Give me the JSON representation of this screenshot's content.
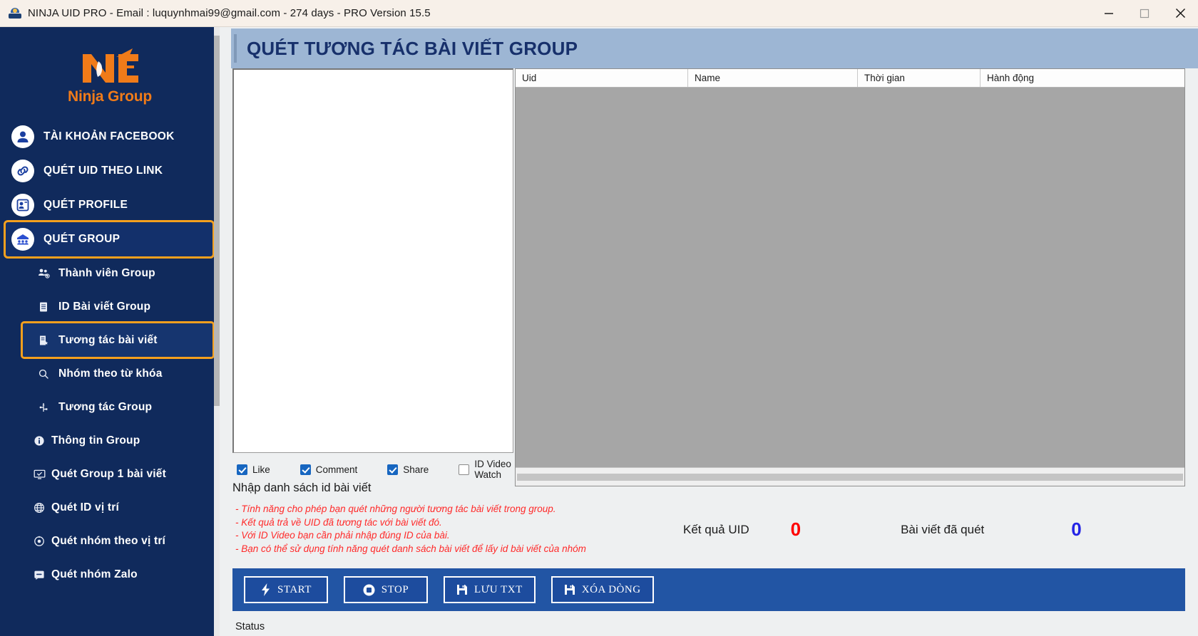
{
  "window": {
    "title": "NINJA UID PRO - Email : luquynhmai99@gmail.com  -  274 days -  PRO Version 15.5",
    "minimize_label": "minimize",
    "maximize_label": "maximize",
    "close_label": "close"
  },
  "sidebar": {
    "logo_text": "Ninja Group",
    "main_items": [
      {
        "label": "TÀI KHOẢN FACEBOOK",
        "icon": "user-icon",
        "selected": false
      },
      {
        "label": "QUÉT UID THEO LINK",
        "icon": "link-icon",
        "selected": false
      },
      {
        "label": "QUÉT PROFILE",
        "icon": "profile-card-icon",
        "selected": false
      },
      {
        "label": "QUÉT GROUP",
        "icon": "group-icon",
        "selected": true
      }
    ],
    "sub_items": [
      {
        "label": "Thành viên Group",
        "icon": "members-icon",
        "selected": false
      },
      {
        "label": "ID Bài viết Group",
        "icon": "document-icon",
        "selected": false
      },
      {
        "label": "Tương tác bài viết",
        "icon": "post-star-icon",
        "selected": true
      },
      {
        "label": "Nhóm theo từ khóa",
        "icon": "search-icon",
        "selected": false
      },
      {
        "label": "Tương tác Group",
        "icon": "usb-icon",
        "selected": false
      },
      {
        "label": "Thông tin Group",
        "icon": "info-icon",
        "selected": false
      },
      {
        "label": "Quét Group 1 bài viết",
        "icon": "monitor-icon",
        "selected": false
      },
      {
        "label": "Quét  ID vị trí",
        "icon": "globe-icon",
        "selected": false
      },
      {
        "label": "Quét nhóm theo vị trí",
        "icon": "target-icon",
        "selected": false
      },
      {
        "label": "Quét nhóm Zalo",
        "icon": "chat-icon",
        "selected": false
      }
    ]
  },
  "page": {
    "title": "QUÉT TƯƠNG TÁC BÀI VIẾT GROUP"
  },
  "input_area": {
    "value": "",
    "label": "Nhập danh sách id bài viết"
  },
  "checkboxes": [
    {
      "label": "Like",
      "checked": true
    },
    {
      "label": "Comment",
      "checked": true
    },
    {
      "label": "Share",
      "checked": true
    },
    {
      "label": "ID Video Watch",
      "checked": false
    }
  ],
  "notes": [
    "- Tính năng cho phép bạn quét những người tương tác bài viết trong group.",
    "- Kết quả trả về UID đã tương tác với bài viết đó.",
    "- Với ID Video bạn cần phải nhập đúng ID của bài.",
    "- Bạn có thể sử dụng tính năng quét danh sách bài viết để lấy id bài viết của nhóm"
  ],
  "table": {
    "columns": [
      "Uid",
      "Name",
      "Thời gian",
      "Hành động"
    ],
    "rows": []
  },
  "counters": {
    "uid_label": "Kết quả UID",
    "uid_value": "0",
    "uid_color": "#FF0000",
    "post_label": "Bài viết đã quét",
    "post_value": "0",
    "post_color": "#2323E6"
  },
  "actions": [
    {
      "label": "START",
      "icon": "lightning-icon"
    },
    {
      "label": "STOP",
      "icon": "stop-icon"
    },
    {
      "label": "LƯU TXT",
      "icon": "save-icon"
    },
    {
      "label": "XÓA DÒNG",
      "icon": "save-icon"
    }
  ],
  "status": {
    "label": "Status"
  },
  "colors": {
    "sidebar_bg": "#102a5c",
    "accent_orange": "#F5A01E",
    "header_blue": "#9db6d4",
    "action_bar": "#2255A4",
    "brand_orange": "#F07B19"
  }
}
